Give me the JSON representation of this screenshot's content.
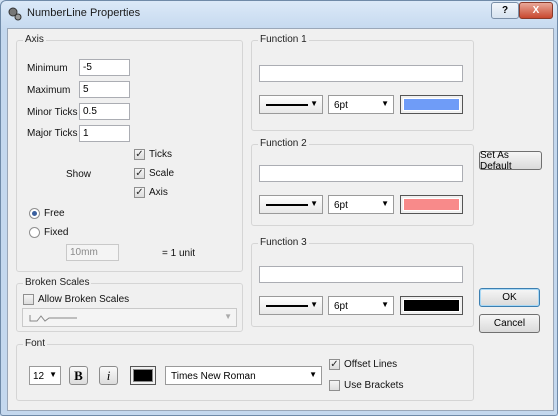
{
  "window": {
    "title": "NumberLine Properties",
    "help_label": "?",
    "close_label": "X"
  },
  "axis": {
    "legend": "Axis",
    "minimum_label": "Minimum",
    "minimum_value": "-5",
    "maximum_label": "Maximum",
    "maximum_value": "5",
    "minor_label": "Minor Ticks",
    "minor_value": "0.5",
    "major_label": "Major Ticks",
    "major_value": "1",
    "show_label": "Show",
    "ticks_label": "Ticks",
    "ticks_checked": true,
    "scale_label": "Scale",
    "scale_checked": true,
    "axis_label": "Axis",
    "axis_checked": true,
    "free_label": "Free",
    "free_selected": true,
    "fixed_label": "Fixed",
    "fixed_selected": false,
    "fixed_value": "10mm",
    "unit_text": "= 1 unit"
  },
  "broken_scales": {
    "legend": "Broken Scales",
    "allow_label": "Allow Broken Scales",
    "allow_checked": false
  },
  "functions": [
    {
      "legend": "Function 1",
      "expression": "",
      "thickness": "6pt",
      "color": "#6f9cf7"
    },
    {
      "legend": "Function 2",
      "expression": "",
      "thickness": "6pt",
      "color": "#f88a8a"
    },
    {
      "legend": "Function 3",
      "expression": "",
      "thickness": "6pt",
      "color": "#000000"
    }
  ],
  "font": {
    "legend": "Font",
    "size": "12",
    "bold_label": "B",
    "italic_label": "i",
    "color": "#000000",
    "family": "Times New Roman",
    "offset_label": "Offset Lines",
    "offset_checked": true,
    "brackets_label": "Use Brackets",
    "brackets_checked": false
  },
  "buttons": {
    "set_default": "Set As Default",
    "ok": "OK",
    "cancel": "Cancel"
  }
}
